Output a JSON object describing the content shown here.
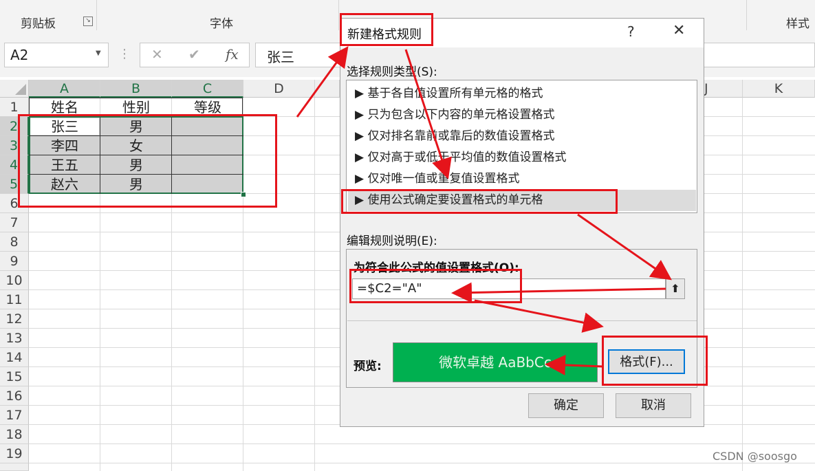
{
  "ribbon": {
    "groups": [
      {
        "label": "剪贴板"
      },
      {
        "label": "字体"
      },
      {
        "label": "样式"
      }
    ]
  },
  "formula_bar": {
    "name_box": "A2",
    "cancel_symbol": "✕",
    "enter_symbol": "✔",
    "fx_symbol": "fx",
    "formula_value": "张三"
  },
  "grid": {
    "columns": [
      "A",
      "B",
      "C",
      "D",
      "J",
      "K"
    ],
    "rows": [
      "1",
      "2",
      "3",
      "4",
      "5",
      "6",
      "7",
      "8",
      "9",
      "10",
      "11",
      "12",
      "13",
      "14",
      "15",
      "16",
      "17",
      "18",
      "19"
    ],
    "cells": [
      [
        "姓名",
        "性别",
        "等级"
      ],
      [
        "张三",
        "男",
        ""
      ],
      [
        "李四",
        "女",
        ""
      ],
      [
        "王五",
        "男",
        ""
      ],
      [
        "赵六",
        "男",
        ""
      ]
    ]
  },
  "dialog": {
    "title": "新建格式规则",
    "help": "?",
    "close": "✕",
    "rule_type_label": "选择规则类型(S):",
    "rule_types": [
      "▶ 基于各自值设置所有单元格的格式",
      "▶ 只为包含以下内容的单元格设置格式",
      "▶ 仅对排名靠前或靠后的数值设置格式",
      "▶ 仅对高于或低于平均值的数值设置格式",
      "▶ 仅对唯一值或重复值设置格式",
      "▶ 使用公式确定要设置格式的单元格"
    ],
    "edit_label": "编辑规则说明(E):",
    "formula_label": "为符合此公式的值设置格式(O):",
    "formula_value": "=$C2=\"A\"",
    "preview_label": "预览:",
    "preview_text": "微软卓越  AaBbCc",
    "format_button": "格式(F)...",
    "ok_button": "确定",
    "cancel_button": "取消"
  },
  "watermark": "CSDN @soosgo",
  "colors": {
    "excel_green": "#217346",
    "preview_bg": "#00b050",
    "annotation_red": "#e5141b",
    "selected_gray": "#d2d2d2"
  }
}
